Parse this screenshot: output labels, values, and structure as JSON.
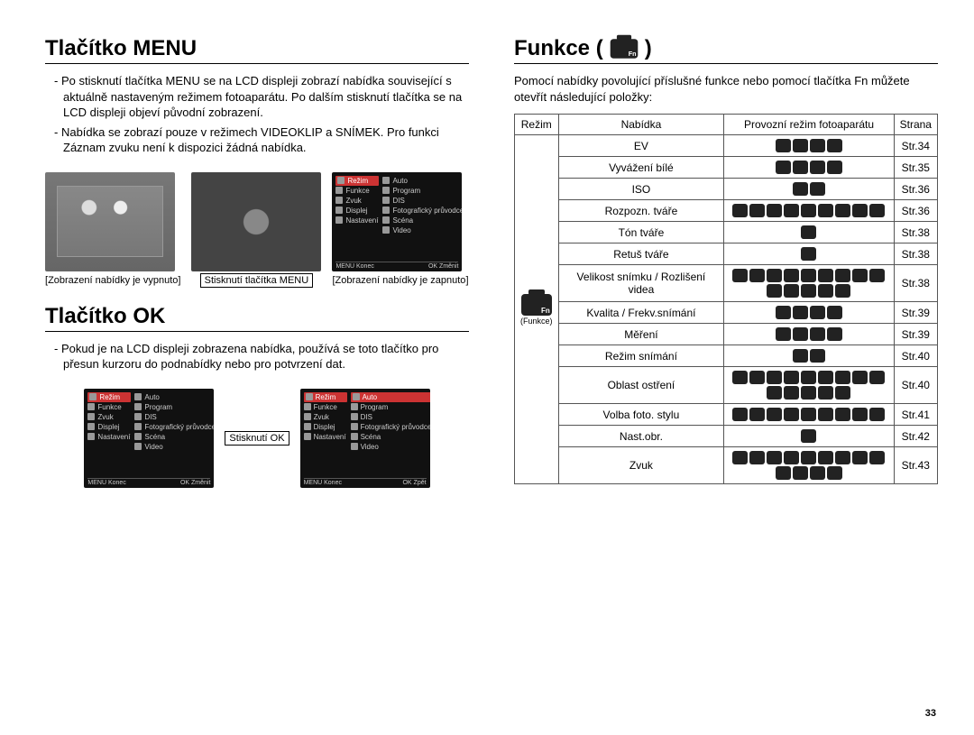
{
  "page_number": "33",
  "left": {
    "title_menu": "Tlačítko MENU",
    "p1": "Po stisknutí tlačítka MENU se na LCD displeji zobrazí nabídka související s aktuálně nastaveným režimem fotoaparátu. Po dalším stisknutí tlačítka se na LCD displeji objeví původní zobrazení.",
    "p2": "Nabídka se zobrazí pouze v režimech VIDEOKLIP a SNÍMEK. Pro funkci Záznam zvuku není k dispozici žádná nabídka.",
    "caption_off": "Zobrazení nabídky je vypnuto",
    "mid_label_menu": "Stisknutí tlačítka MENU",
    "caption_on": "Zobrazení nabídky je zapnuto",
    "title_ok": "Tlačítko OK",
    "p_ok": "Pokud je na LCD displeji zobrazena nabídka, používá se toto tlačítko pro přesun kurzoru do podnabídky nebo pro potvrzení dat.",
    "mid_label_ok": "Stisknutí OK",
    "menu_items_left": [
      "Režim",
      "Funkce",
      "Zvuk",
      "Displej",
      "Nastavení"
    ],
    "menu_items_right": [
      "Auto",
      "Program",
      "DIS",
      "Fotografický průvodce",
      "Scéna",
      "Video"
    ],
    "menu_footer_left": "Konec",
    "menu_footer_right_change": "Změnit",
    "menu_footer_right_back": "Zpět"
  },
  "right": {
    "title": "Funkce (",
    "title_suffix": ")",
    "intro": "Pomocí nabídky povolující příslušné funkce nebo pomocí tlačítka Fn můžete otevřít následující položky:",
    "header": {
      "mode": "Režim",
      "menu": "Nabídka",
      "operating": "Provozní režim fotoaparátu",
      "page": "Strana"
    },
    "modecell_label": "(Funkce)",
    "rows": [
      {
        "menu": "EV",
        "icons": 4,
        "page": "Str.34"
      },
      {
        "menu": "Vyvážení  bílé",
        "icons": 4,
        "page": "Str.35"
      },
      {
        "menu": "ISO",
        "icons": 2,
        "page": "Str.36"
      },
      {
        "menu": "Rozpozn. tváře",
        "icons": 9,
        "page": "Str.36"
      },
      {
        "menu": "Tón tváře",
        "icons": 1,
        "page": "Str.38"
      },
      {
        "menu": "Retuš tváře",
        "icons": 1,
        "page": "Str.38"
      },
      {
        "menu": "Velikost snímku / Rozlišení videa",
        "icons": 14,
        "page": "Str.38"
      },
      {
        "menu": "Kvalita / Frekv.snímání",
        "icons": 4,
        "page": "Str.39"
      },
      {
        "menu": "Měření",
        "icons": 4,
        "page": "Str.39"
      },
      {
        "menu": "Režim snímání",
        "icons": 2,
        "page": "Str.40"
      },
      {
        "menu": "Oblast ostření",
        "icons": 14,
        "page": "Str.40"
      },
      {
        "menu": "Volba foto. stylu",
        "icons": 9,
        "page": "Str.41"
      },
      {
        "menu": "Nast.obr.",
        "icons": 1,
        "page": "Str.42"
      },
      {
        "menu": "Zvuk",
        "icons": 13,
        "page": "Str.43"
      }
    ]
  }
}
